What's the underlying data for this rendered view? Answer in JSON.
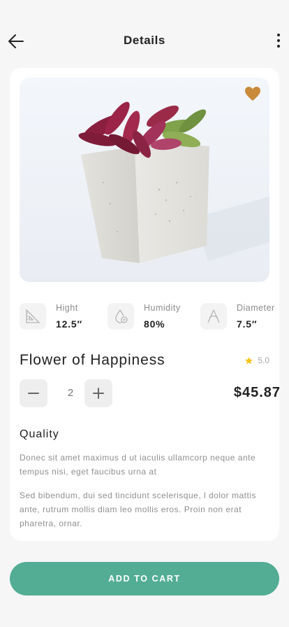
{
  "header": {
    "title": "Details"
  },
  "product": {
    "name": "Flower of Happiness",
    "rating": "5.0",
    "price": "$45.87",
    "quantity": "2"
  },
  "specs": [
    {
      "label": "Hight",
      "value": "12.5″",
      "icon": "ruler-triangle-icon"
    },
    {
      "label": "Humidity",
      "value": "80%",
      "icon": "water-drop-icon"
    },
    {
      "label": "Diameter",
      "value": "7.5″",
      "icon": "compass-icon"
    }
  ],
  "details": {
    "section_title": "Quality",
    "paragraphs": [
      "Donec sit amet maximus d ut iaculis ullamcorp neque ante tempus nisi, eget faucibus urna at",
      "Sed bibendum, dui sed tincidunt scelerisque, l dolor mattis ante, rutrum mollis diam leo mollis eros. Proin non erat pharetra, ornar."
    ]
  },
  "actions": {
    "add_to_cart": "ADD TO CART"
  },
  "colors": {
    "accent": "#53ad94",
    "favorite": "#c98a3a",
    "star": "#f5c518"
  }
}
